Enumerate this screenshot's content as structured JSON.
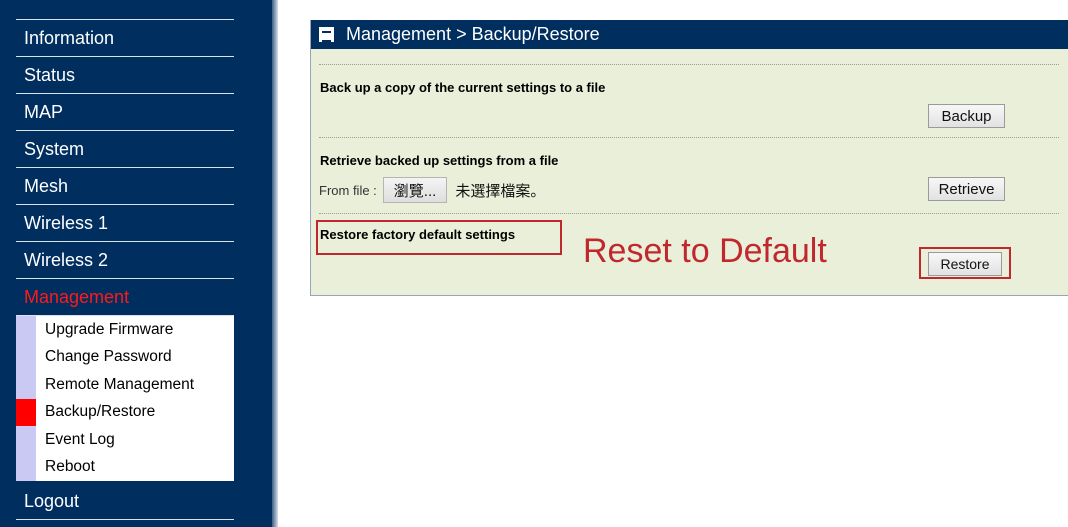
{
  "sidebar": {
    "items": [
      {
        "label": "Information"
      },
      {
        "label": "Status"
      },
      {
        "label": "MAP"
      },
      {
        "label": "System"
      },
      {
        "label": "Mesh"
      },
      {
        "label": "Wireless 1"
      },
      {
        "label": "Wireless 2"
      },
      {
        "label": "Management"
      }
    ],
    "submenu": [
      {
        "label": "Upgrade Firmware"
      },
      {
        "label": "Change Password"
      },
      {
        "label": "Remote Management"
      },
      {
        "label": "Backup/Restore"
      },
      {
        "label": "Event Log"
      },
      {
        "label": "Reboot"
      }
    ],
    "logout": "Logout",
    "active_item": "Management",
    "active_subitem": "Backup/Restore"
  },
  "panel": {
    "title": "Management > Backup/Restore",
    "backup": {
      "title": "Back up a copy of the current settings to a file",
      "button": "Backup"
    },
    "retrieve": {
      "title": "Retrieve backed up settings from a file",
      "from_file_label": "From file :",
      "browse_button": "瀏覽...",
      "no_file_text": "未選擇檔案。",
      "button": "Retrieve"
    },
    "restore": {
      "title": "Restore factory default settings",
      "button": "Restore"
    }
  },
  "annotation": {
    "text": "Reset to Default",
    "color": "#c0282d"
  },
  "colors": {
    "navy": "#002e5e",
    "panel_bg": "#e9efd9",
    "active_red": "#ff1a1a",
    "submenu_mark": "#c9c9f4"
  }
}
